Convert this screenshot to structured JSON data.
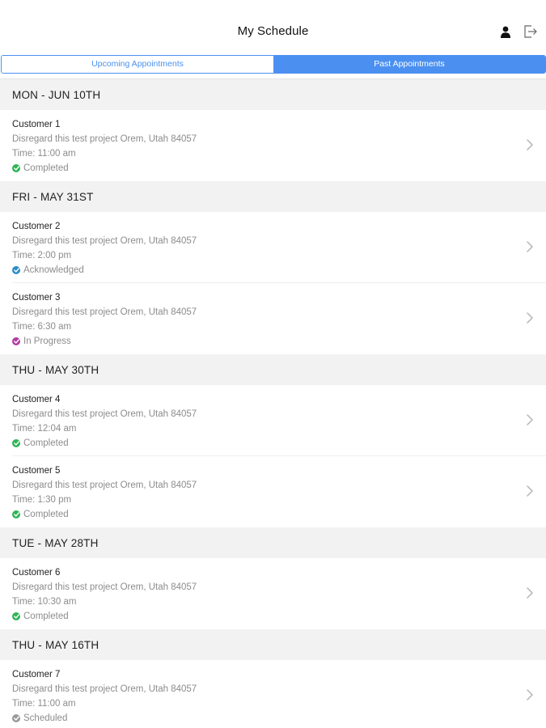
{
  "header": {
    "title": "My Schedule",
    "profile_icon": "person-icon",
    "logout_icon": "logout-icon"
  },
  "tabs": [
    {
      "label": "Upcoming Appointments",
      "selected": false
    },
    {
      "label": "Past Appointments",
      "selected": true
    }
  ],
  "colors": {
    "accent": "#4b90f1",
    "completed": "#2fb457",
    "acknowledged": "#2b8cc9",
    "in_progress": "#b23ba4",
    "scheduled": "#9a9a9a"
  },
  "sections": [
    {
      "header": "MON - JUN 10TH",
      "items": [
        {
          "name": "Customer 1",
          "address": "Disregard this test project Orem, Utah 84057",
          "time": "Time: 11:00 am",
          "status": "Completed",
          "status_key": "completed"
        }
      ]
    },
    {
      "header": "FRI - MAY 31ST",
      "items": [
        {
          "name": "Customer 2",
          "address": "Disregard this test project Orem, Utah 84057",
          "time": "Time: 2:00 pm",
          "status": "Acknowledged",
          "status_key": "acknowledged"
        },
        {
          "name": "Customer 3",
          "address": "Disregard this test project Orem, Utah 84057",
          "time": "Time: 6:30 am",
          "status": "In Progress",
          "status_key": "in_progress"
        }
      ]
    },
    {
      "header": "THU - MAY 30TH",
      "items": [
        {
          "name": "Customer 4",
          "address": "Disregard this test project Orem, Utah 84057",
          "time": "Time: 12:04 am",
          "status": "Completed",
          "status_key": "completed"
        },
        {
          "name": "Customer 5",
          "address": "Disregard this test project Orem, Utah 84057",
          "time": "Time: 1:30 pm",
          "status": "Completed",
          "status_key": "completed"
        }
      ]
    },
    {
      "header": "TUE - MAY 28TH",
      "items": [
        {
          "name": "Customer 6",
          "address": "Disregard this test project Orem, Utah 84057",
          "time": "Time: 10:30 am",
          "status": "Completed",
          "status_key": "completed"
        }
      ]
    },
    {
      "header": "THU - MAY 16TH",
      "items": [
        {
          "name": "Customer 7",
          "address": "Disregard this test project Orem, Utah 84057",
          "time": "Time: 11:00 am",
          "status": "Scheduled",
          "status_key": "scheduled"
        }
      ]
    }
  ]
}
